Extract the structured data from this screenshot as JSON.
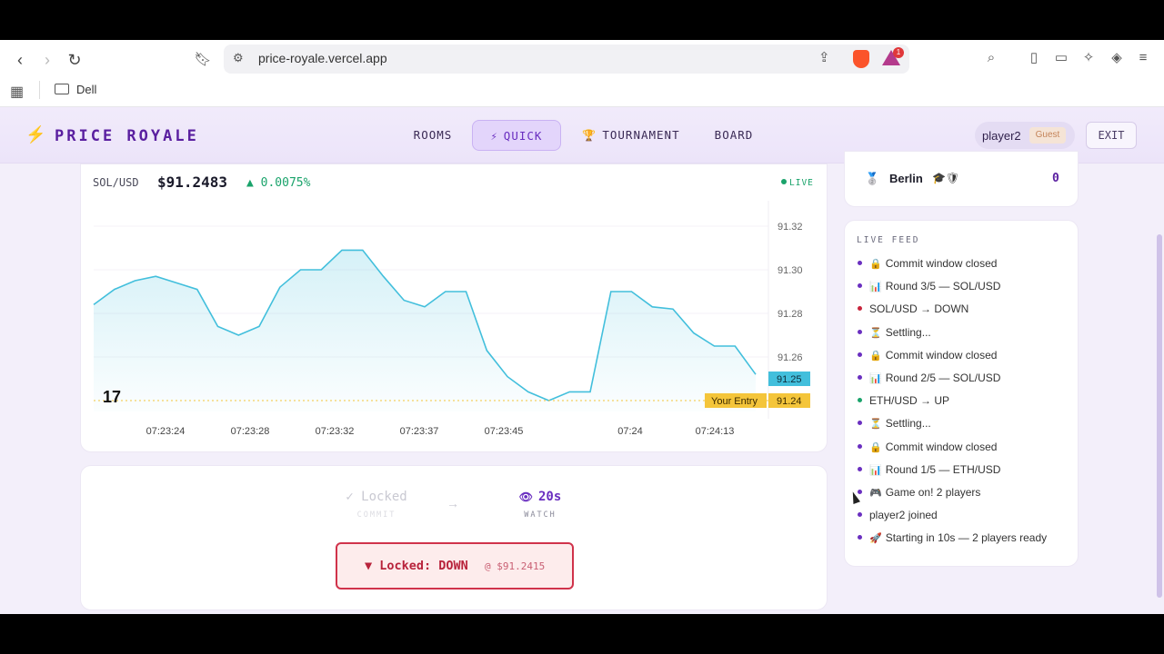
{
  "browser": {
    "url": "price-royale.vercel.app",
    "rewards_badge": "1",
    "bookmark_folder": "Dell"
  },
  "header": {
    "logo": "PRICE ROYALE",
    "tabs": [
      {
        "label": "ROOMS",
        "icon": ""
      },
      {
        "label": "QUICK",
        "icon": "⚡"
      },
      {
        "label": "TOURNAMENT",
        "icon": "🏆"
      },
      {
        "label": "BOARD",
        "icon": ""
      }
    ],
    "active_tab": "QUICK",
    "user": "player2",
    "guest_badge": "Guest",
    "exit_label": "EXIT"
  },
  "ticker": {
    "pair": "SOL/USD",
    "price": "$91.2483",
    "change": "▲ 0.0075%",
    "live_label": "LIVE"
  },
  "chart_data": {
    "type": "area",
    "x_ticks": [
      "07:23:24",
      "07:23:28",
      "07:23:32",
      "07:23:37",
      "07:23:45",
      "07:24",
      "07:24:13"
    ],
    "y_ticks": [
      "91.32",
      "91.30",
      "91.28",
      "91.26"
    ],
    "ylim": [
      91.235,
      91.33
    ],
    "values": [
      91.284,
      91.291,
      91.295,
      91.297,
      91.294,
      91.291,
      91.274,
      91.27,
      91.274,
      91.292,
      91.3,
      91.3,
      91.309,
      91.309,
      91.297,
      91.286,
      91.283,
      91.29,
      91.29,
      91.263,
      91.251,
      91.244,
      91.24,
      91.244,
      91.244,
      91.29,
      91.29,
      91.283,
      91.282,
      91.271,
      91.265,
      91.265,
      91.252
    ],
    "current_price_label": "91.25",
    "entry_price_label": "91.24",
    "entry_tag": "Your Entry",
    "colors": {
      "line": "#42bfdc",
      "current": "#42bfdc",
      "entry": "#f4c53a"
    }
  },
  "commit": {
    "step1_label": "✓ Locked",
    "step1_sub": "COMMIT",
    "arrow": "→",
    "step2_label": "20s",
    "step2_sub": "WATCH",
    "locked_label": "▼ Locked: DOWN",
    "locked_at": "@ $91.2415"
  },
  "ranking": {
    "name": "Berlin",
    "icons": "🎓🛡",
    "score": "0"
  },
  "feed": {
    "title": "LIVE FEED",
    "items": [
      {
        "emoji": "🔒",
        "text": "Commit window closed",
        "dot": "#6a2fc0"
      },
      {
        "emoji": "📊",
        "text": "Round 3/5 — SOL/USD",
        "dot": "#6a2fc0"
      },
      {
        "emoji": "",
        "text": "SOL/USD → DOWN",
        "dot": "#c8243c"
      },
      {
        "emoji": "⏳",
        "text": "Settling...",
        "dot": "#6a2fc0"
      },
      {
        "emoji": "🔒",
        "text": "Commit window closed",
        "dot": "#6a2fc0"
      },
      {
        "emoji": "📊",
        "text": "Round 2/5 — SOL/USD",
        "dot": "#6a2fc0"
      },
      {
        "emoji": "",
        "text": "ETH/USD → UP",
        "dot": "#1aa36b"
      },
      {
        "emoji": "⏳",
        "text": "Settling...",
        "dot": "#6a2fc0"
      },
      {
        "emoji": "🔒",
        "text": "Commit window closed",
        "dot": "#6a2fc0"
      },
      {
        "emoji": "📊",
        "text": "Round 1/5 — ETH/USD",
        "dot": "#6a2fc0"
      },
      {
        "emoji": "🎮",
        "text": "Game on! 2 players",
        "dot": "#6a2fc0"
      },
      {
        "emoji": "",
        "text": "player2 joined",
        "dot": "#6a2fc0"
      },
      {
        "emoji": "🚀",
        "text": "Starting in 10s — 2 players ready",
        "dot": "#6a2fc0"
      }
    ]
  }
}
